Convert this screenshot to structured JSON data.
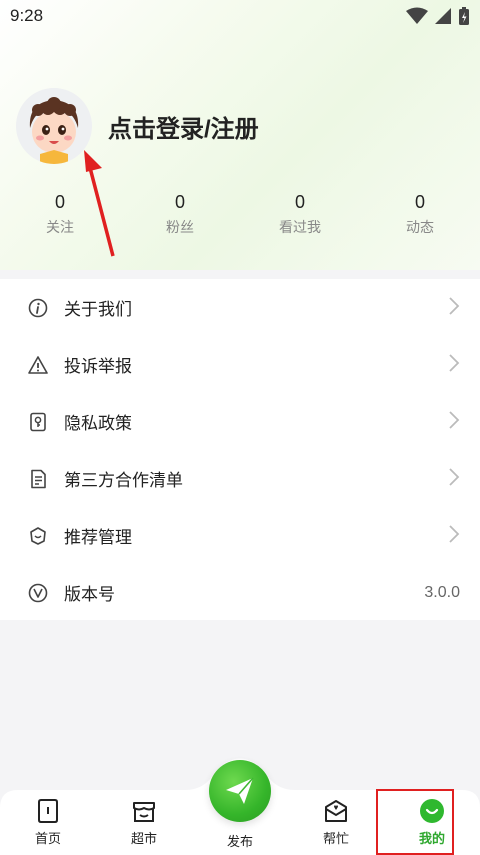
{
  "status_bar": {
    "time": "9:28"
  },
  "profile": {
    "login_text": "点击登录/注册"
  },
  "stats": [
    {
      "value": "0",
      "label": "关注"
    },
    {
      "value": "0",
      "label": "粉丝"
    },
    {
      "value": "0",
      "label": "看过我"
    },
    {
      "value": "0",
      "label": "动态"
    }
  ],
  "menu": [
    {
      "label": "关于我们",
      "icon": "info-icon"
    },
    {
      "label": "投诉举报",
      "icon": "warning-icon"
    },
    {
      "label": "隐私政策",
      "icon": "privacy-lock-icon"
    },
    {
      "label": "第三方合作清单",
      "icon": "document-list-icon"
    },
    {
      "label": "推荐管理",
      "icon": "recommend-icon"
    },
    {
      "label": "版本号",
      "icon": "version-icon",
      "value": "3.0.0"
    }
  ],
  "tabbar": {
    "tabs": [
      {
        "label": "首页",
        "icon": "home-icon"
      },
      {
        "label": "超市",
        "icon": "store-icon"
      },
      {
        "label": "发布",
        "icon": "send-icon"
      },
      {
        "label": "帮忙",
        "icon": "help-mail-icon"
      },
      {
        "label": "我的",
        "icon": "profile-smile-icon"
      }
    ],
    "active_index": 4
  },
  "colors": {
    "accent": "#2fa82f",
    "annotation": "#e02020"
  }
}
